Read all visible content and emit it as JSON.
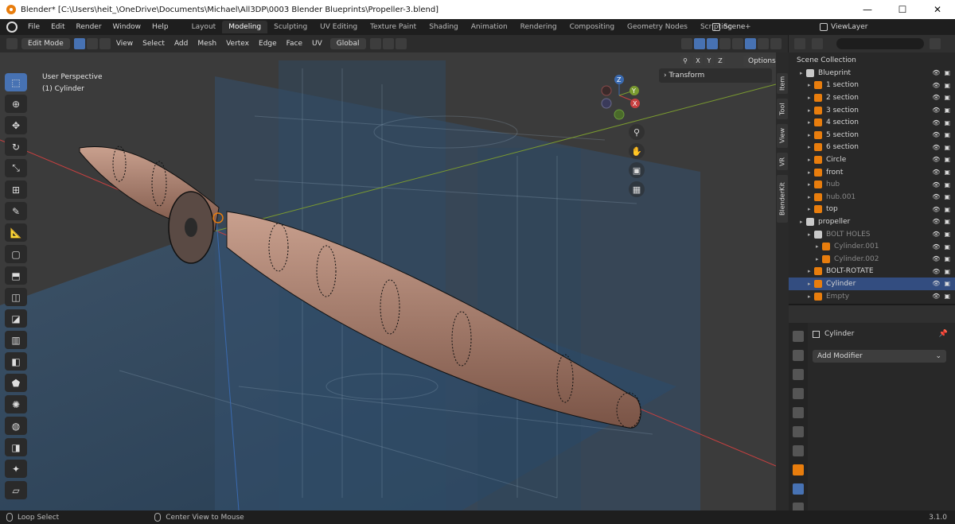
{
  "window": {
    "title": "Blender* [C:\\Users\\heit_\\OneDrive\\Documents\\Michael\\All3DP\\0003 Blender Blueprints\\Propeller-3.blend]",
    "min_glyph": "—",
    "max_glyph": "☐",
    "close_glyph": "✕"
  },
  "menu": [
    "File",
    "Edit",
    "Render",
    "Window",
    "Help"
  ],
  "workspaces": [
    "Layout",
    "Modeling",
    "Sculpting",
    "UV Editing",
    "Texture Paint",
    "Shading",
    "Animation",
    "Rendering",
    "Compositing",
    "Geometry Nodes",
    "Scripting"
  ],
  "active_workspace": "Modeling",
  "add_workspace": "+",
  "scene": "Scene",
  "view_layer": "ViewLayer",
  "viewport_header": {
    "mode": "Edit Mode",
    "menus": [
      "View",
      "Select",
      "Add",
      "Mesh",
      "Vertex",
      "Edge",
      "Face",
      "UV"
    ],
    "orientation": "Global",
    "options": "Options",
    "axes": [
      "X",
      "Y",
      "Z"
    ]
  },
  "viewport": {
    "perspective": "User Perspective",
    "object": "(1) Cylinder",
    "transform_panel": "Transform",
    "gizmo": {
      "x": "X",
      "y": "Y",
      "z": "Z"
    }
  },
  "side_tabs": [
    "Item",
    "Tool",
    "View",
    "VR",
    "BlenderKit"
  ],
  "outliner": {
    "root": "Scene Collection",
    "rows": [
      {
        "name": "Blueprint",
        "kind": "collection",
        "depth": 0
      },
      {
        "name": "1 section",
        "kind": "image",
        "depth": 1
      },
      {
        "name": "2 section",
        "kind": "image",
        "depth": 1
      },
      {
        "name": "3 section",
        "kind": "image",
        "depth": 1
      },
      {
        "name": "4 section",
        "kind": "image",
        "depth": 1
      },
      {
        "name": "5 section",
        "kind": "image",
        "depth": 1
      },
      {
        "name": "6 section",
        "kind": "image",
        "depth": 1
      },
      {
        "name": "Circle",
        "kind": "mesh",
        "depth": 1
      },
      {
        "name": "front",
        "kind": "image",
        "depth": 1
      },
      {
        "name": "hub",
        "kind": "image",
        "depth": 1,
        "dim": true
      },
      {
        "name": "hub.001",
        "kind": "image",
        "depth": 1,
        "dim": true
      },
      {
        "name": "top",
        "kind": "image",
        "depth": 1
      },
      {
        "name": "propeller",
        "kind": "collection",
        "depth": 0
      },
      {
        "name": "BOLT HOLES",
        "kind": "collection",
        "depth": 1,
        "dim": true
      },
      {
        "name": "Cylinder.001",
        "kind": "mesh",
        "depth": 2,
        "dim": true
      },
      {
        "name": "Cylinder.002",
        "kind": "mesh",
        "depth": 2,
        "dim": true
      },
      {
        "name": "BOLT-ROTATE",
        "kind": "empty",
        "depth": 1
      },
      {
        "name": "Cylinder",
        "kind": "mesh",
        "depth": 1
      },
      {
        "name": "Empty",
        "kind": "empty",
        "depth": 1,
        "dim": true
      }
    ]
  },
  "properties": {
    "object_name": "Cylinder",
    "add_modifier": "Add Modifier"
  },
  "statusbar": {
    "left": "Loop Select",
    "middle": "Center View to Mouse",
    "version": "3.1.0"
  },
  "colors": {
    "accent": "#4772b3",
    "orange": "#e87d0d",
    "blueprint": "#2e4a66",
    "mesh": "#b08070"
  }
}
